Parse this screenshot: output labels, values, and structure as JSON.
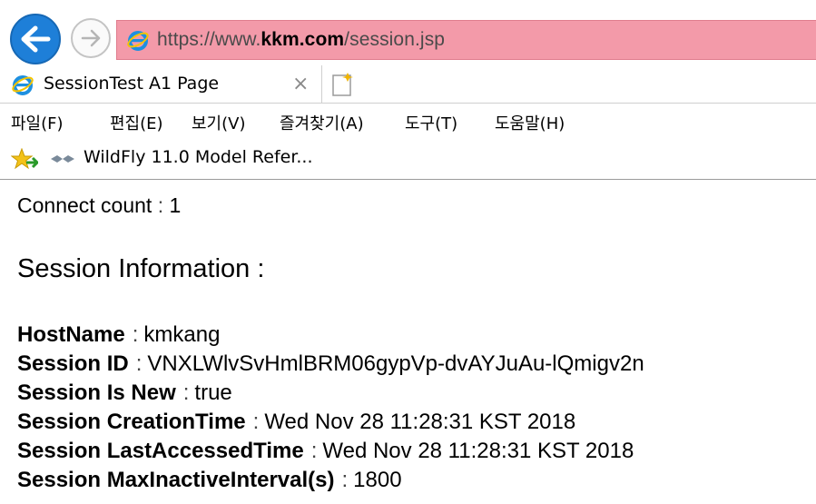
{
  "browser": {
    "url_prefix": "https://www.",
    "url_domain": "kkm.com",
    "url_path": "/session.jsp",
    "tab_title": "SessionTest A1 Page",
    "tab_close": "×",
    "menu": [
      "파일(F)",
      "편집(E)",
      "보기(V)",
      "즐겨찾기(A)",
      "도구(T)",
      "도움말(H)"
    ],
    "favorite": "WildFly 11.0 Model Refer..."
  },
  "page": {
    "connect_label": "Connect count",
    "connect_value": "1",
    "heading": "Session Information :",
    "separator": ":",
    "fields": [
      {
        "label": "HostName",
        "value": "kmkang"
      },
      {
        "label": "Session ID",
        "value": "VNXLWlvSvHmlBRM06gypVp-dvAYJuAu-lQmigv2n"
      },
      {
        "label": "Session Is New",
        "value": "true"
      },
      {
        "label": "Session CreationTime",
        "value": "Wed Nov 28 11:28:31 KST 2018"
      },
      {
        "label": "Session LastAccessedTime",
        "value": "Wed Nov 28 11:28:31 KST 2018"
      },
      {
        "label": "Session MaxInactiveInterval(s)",
        "value": "1800"
      }
    ]
  },
  "colors": {
    "back_button": "#1e7fd8",
    "address_bar": "#f39aa9",
    "ie_blue": "#1e90e0"
  }
}
